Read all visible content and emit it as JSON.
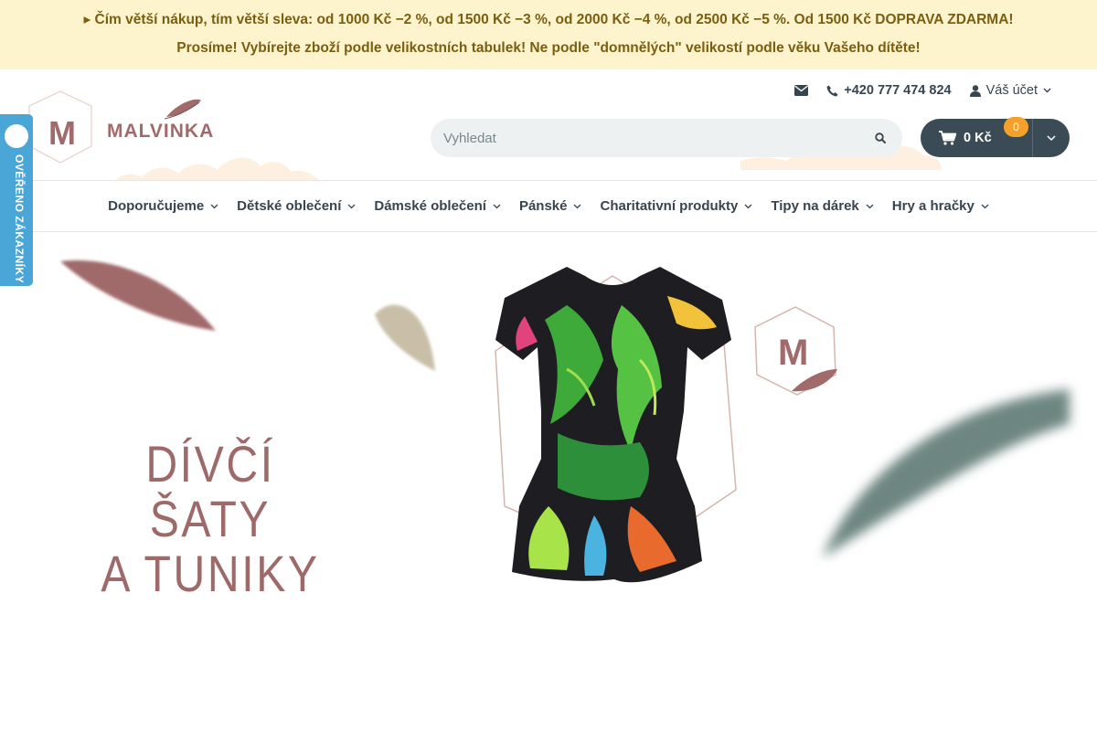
{
  "promo": {
    "line1_icon": "star-icon",
    "line1": "Čím větší nákup, tím větší sleva: od 1000 Kč −2 %, od 1500 Kč −3 %, od 2000 Kč −4 %, od 2500 Kč −5 %. Od 1500 Kč DOPRAVA ZDARMA!",
    "line2": "Prosíme! Vybírejte zboží podle velikostních tabulek! Ne podle \"domnělých\" velikostí podle věku Vašeho dítěte!"
  },
  "header": {
    "logo": {
      "monogram": "M",
      "brand": "MALVINKA"
    },
    "contact": {
      "email_icon": "envelope-icon",
      "phone_icon": "phone-icon",
      "phone": "+420 777 474 824"
    },
    "account": {
      "icon": "user-icon",
      "label": "Váš účet"
    },
    "search": {
      "placeholder": "Vyhledat",
      "icon": "search-icon"
    },
    "cart": {
      "icon": "cart-icon",
      "price": "0 Kč",
      "count": "0"
    }
  },
  "nav": {
    "items": [
      {
        "label": "Doporučujeme"
      },
      {
        "label": "Dětské oblečení"
      },
      {
        "label": "Dámské oblečení"
      },
      {
        "label": "Pánské"
      },
      {
        "label": "Charitativní produkty"
      },
      {
        "label": "Tipy na dárek"
      },
      {
        "label": "Hry a hračky"
      }
    ]
  },
  "trust_badge": {
    "label": "OVĚŘENO ZÁKAZNÍKY"
  },
  "hero": {
    "title_line1": "DÍVČÍ ŠATY",
    "title_line2": "A TUNIKY",
    "monogram": "M"
  },
  "colors": {
    "promo_bg": "#fdf3cd",
    "promo_text": "#7a5e12",
    "brand": "#a16a6b",
    "cart_bg": "#3b4b55",
    "cart_badge": "#f4a12a",
    "trust_badge": "#4aa6d6"
  }
}
